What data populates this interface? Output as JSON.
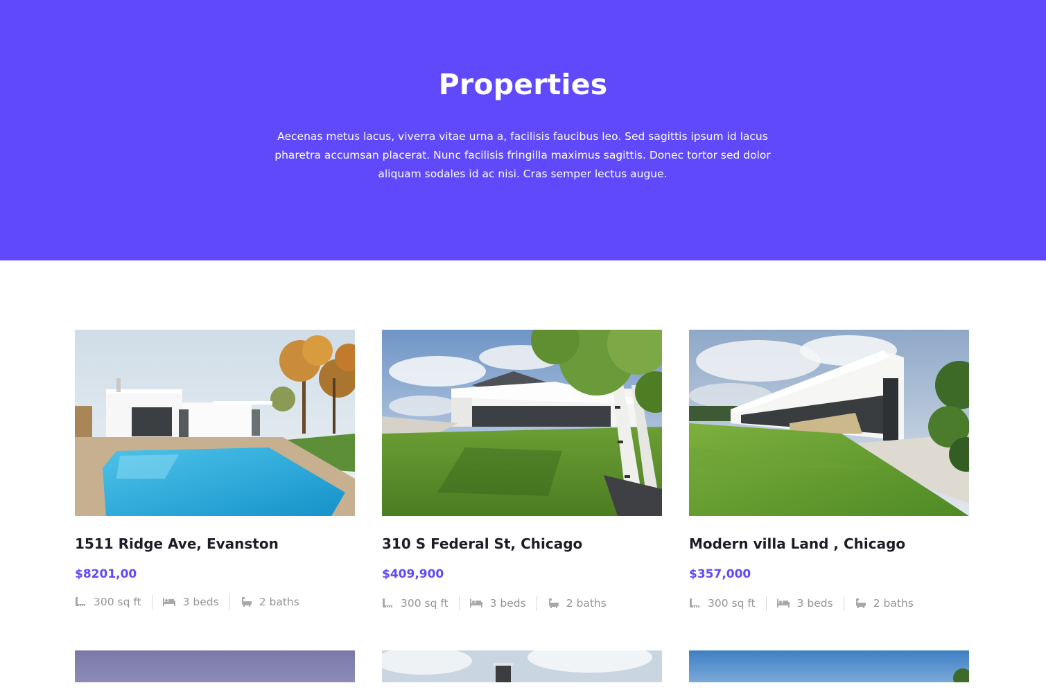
{
  "hero": {
    "title": "Properties",
    "description": "Aecenas metus lacus, viverra vitae urna a, facilisis faucibus leo. Sed sagittis ipsum id lacus pharetra accumsan placerat. Nunc facilisis fringilla maximus sagittis. Donec tortor sed dolor aliquam sodales id ac nisi. Cras semper lectus augue.",
    "background_color": "#6049fa"
  },
  "accent_color": "#6049fa",
  "properties": [
    {
      "title": "1511 Ridge Ave, Evanston",
      "price": "$8201,00",
      "area": "300 sq ft",
      "beds": "3 beds",
      "baths": "2 baths"
    },
    {
      "title": "310 S Federal St, Chicago",
      "price": "$409,900",
      "area": "300 sq ft",
      "beds": "3 beds",
      "baths": "2 baths"
    },
    {
      "title": "Modern villa Land , Chicago",
      "price": "$357,000",
      "area": "300 sq ft",
      "beds": "3 beds",
      "baths": "2 baths"
    }
  ],
  "icons": {
    "area": "ruler-area-icon",
    "beds": "bed-icon",
    "baths": "bathtub-icon"
  }
}
